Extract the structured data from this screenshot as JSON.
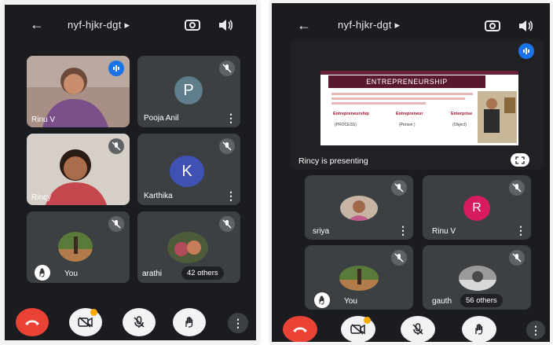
{
  "left": {
    "meeting_code": "nyf-hjkr-dgt",
    "tiles": [
      {
        "name": "Rinu V"
      },
      {
        "name": "Pooja Anil",
        "initial": "P",
        "color": "#607d8b"
      },
      {
        "name": "Rincy"
      },
      {
        "name": "Karthika",
        "initial": "K",
        "color": "#3f51b5"
      },
      {
        "name": "You"
      },
      {
        "name": "arathi",
        "others": "42 others"
      }
    ]
  },
  "right": {
    "meeting_code": "nyf-hjkr-dgt",
    "presenting_label": "Rincy is presenting",
    "slide_title": "ENTREPRENEURSHIP",
    "slide_items": [
      "Entrepreneurship",
      "Entrepreneur",
      "Enterprise"
    ],
    "slide_subitems": [
      "(PROCESS)",
      "(Person )",
      "(Object)"
    ],
    "tiles": [
      {
        "name": "sriya"
      },
      {
        "name": "Rinu V",
        "initial": "R",
        "color": "#d81b60"
      },
      {
        "name": "You"
      },
      {
        "name": "gauth",
        "others": "56 others"
      }
    ]
  },
  "colors": {
    "background": "#1b1c1f",
    "tile": "#3c4043",
    "end_call": "#ea4335",
    "speaking": "#1a73e8"
  }
}
